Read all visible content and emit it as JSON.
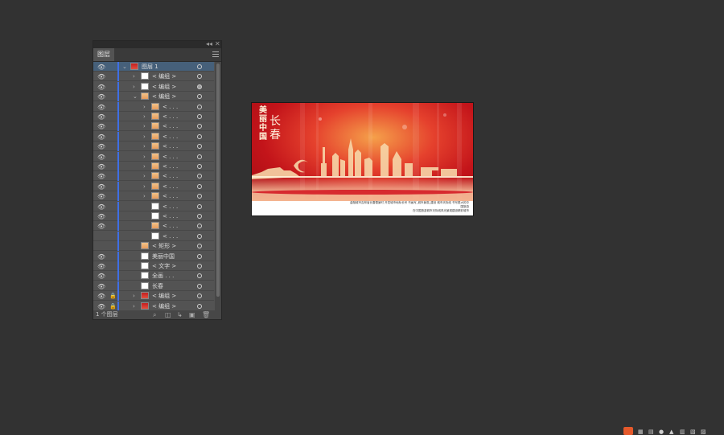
{
  "panel": {
    "tab_label": "图层",
    "collapse_glyph": "◂◂",
    "close_glyph": "✕",
    "footer_count": "1 个图层",
    "layers": [
      {
        "name": "图层 1",
        "indent": 0,
        "expander": "v",
        "thumb": "red",
        "eye": true,
        "lock": false,
        "selected": true,
        "target": "open"
      },
      {
        "name": "< 编组 >",
        "indent": 1,
        "expander": ">",
        "thumb": "white",
        "eye": true,
        "lock": false,
        "selected": false,
        "target": "open"
      },
      {
        "name": "< 编组 >",
        "indent": 1,
        "expander": ">",
        "thumb": "white",
        "eye": true,
        "lock": false,
        "selected": false,
        "target": "filled"
      },
      {
        "name": "< 编组 >",
        "indent": 1,
        "expander": "v",
        "thumb": "warm",
        "eye": true,
        "lock": false,
        "selected": false,
        "target": "open"
      },
      {
        "name": "< . . .",
        "indent": 2,
        "expander": ">",
        "thumb": "warm",
        "eye": true,
        "lock": false,
        "selected": false,
        "target": "open"
      },
      {
        "name": "< . . .",
        "indent": 2,
        "expander": ">",
        "thumb": "warm",
        "eye": true,
        "lock": false,
        "selected": false,
        "target": "open"
      },
      {
        "name": "< . . .",
        "indent": 2,
        "expander": ">",
        "thumb": "warm",
        "eye": true,
        "lock": false,
        "selected": false,
        "target": "open"
      },
      {
        "name": "< . . .",
        "indent": 2,
        "expander": ">",
        "thumb": "warm",
        "eye": true,
        "lock": false,
        "selected": false,
        "target": "open"
      },
      {
        "name": "< . . .",
        "indent": 2,
        "expander": ">",
        "thumb": "warm",
        "eye": true,
        "lock": false,
        "selected": false,
        "target": "open"
      },
      {
        "name": "< . . .",
        "indent": 2,
        "expander": ">",
        "thumb": "warm",
        "eye": true,
        "lock": false,
        "selected": false,
        "target": "open"
      },
      {
        "name": "< . . .",
        "indent": 2,
        "expander": ">",
        "thumb": "warm",
        "eye": true,
        "lock": false,
        "selected": false,
        "target": "open"
      },
      {
        "name": "< . . .",
        "indent": 2,
        "expander": ">",
        "thumb": "warm",
        "eye": true,
        "lock": false,
        "selected": false,
        "target": "open"
      },
      {
        "name": "< . . .",
        "indent": 2,
        "expander": ">",
        "thumb": "warm",
        "eye": true,
        "lock": false,
        "selected": false,
        "target": "open"
      },
      {
        "name": "< . . .",
        "indent": 2,
        "expander": ">",
        "thumb": "warm",
        "eye": true,
        "lock": false,
        "selected": false,
        "target": "open"
      },
      {
        "name": "< . . .",
        "indent": 2,
        "expander": "",
        "thumb": "white",
        "eye": true,
        "lock": false,
        "selected": false,
        "target": "open"
      },
      {
        "name": "< . . .",
        "indent": 2,
        "expander": "",
        "thumb": "white",
        "eye": true,
        "lock": false,
        "selected": false,
        "target": "open"
      },
      {
        "name": "< . . .",
        "indent": 2,
        "expander": "",
        "thumb": "warm",
        "eye": true,
        "lock": false,
        "selected": false,
        "target": "open"
      },
      {
        "name": "< . . .",
        "indent": 2,
        "expander": "",
        "thumb": "white",
        "eye": false,
        "lock": false,
        "selected": false,
        "target": "open"
      },
      {
        "name": "< 矩形 >",
        "indent": 1,
        "expander": "",
        "thumb": "warm",
        "eye": false,
        "lock": false,
        "selected": false,
        "target": "open"
      },
      {
        "name": "美丽中国",
        "indent": 1,
        "expander": "",
        "thumb": "white",
        "eye": true,
        "lock": false,
        "selected": false,
        "target": "open"
      },
      {
        "name": "< 文字 >",
        "indent": 1,
        "expander": "",
        "thumb": "white",
        "eye": true,
        "lock": false,
        "selected": false,
        "target": "open"
      },
      {
        "name": "全画 . . .",
        "indent": 1,
        "expander": "",
        "thumb": "white",
        "eye": true,
        "lock": false,
        "selected": false,
        "target": "open"
      },
      {
        "name": "长春",
        "indent": 1,
        "expander": "",
        "thumb": "white",
        "eye": true,
        "lock": false,
        "selected": false,
        "target": "open"
      },
      {
        "name": "< 编组 >",
        "indent": 1,
        "expander": ">",
        "thumb": "red",
        "eye": true,
        "lock": true,
        "selected": false,
        "target": "open"
      },
      {
        "name": "< 编组 >",
        "indent": 1,
        "expander": ">",
        "thumb": "red",
        "eye": true,
        "lock": true,
        "selected": false,
        "target": "open"
      }
    ],
    "footer_buttons": [
      "locate-object-icon",
      "make-clipping-mask-icon",
      "new-sublayer-icon",
      "new-layer-icon",
      "delete-layer-icon"
    ]
  },
  "artboard": {
    "vertical_title": "美丽中国",
    "city": "长春",
    "caption_line1": "金融城市吉林省长春雪景时 开发城市地标长号 书画写_城市景观_建设 城市天际线 书写更大的中国旅游",
    "caption_line2": "在中国旅游城市天际线风光景观建设精彩城市"
  },
  "colors": {
    "background": "#323232",
    "panel": "#535353",
    "selection": "#46607a",
    "layer_bar": "#3f6fe6"
  }
}
